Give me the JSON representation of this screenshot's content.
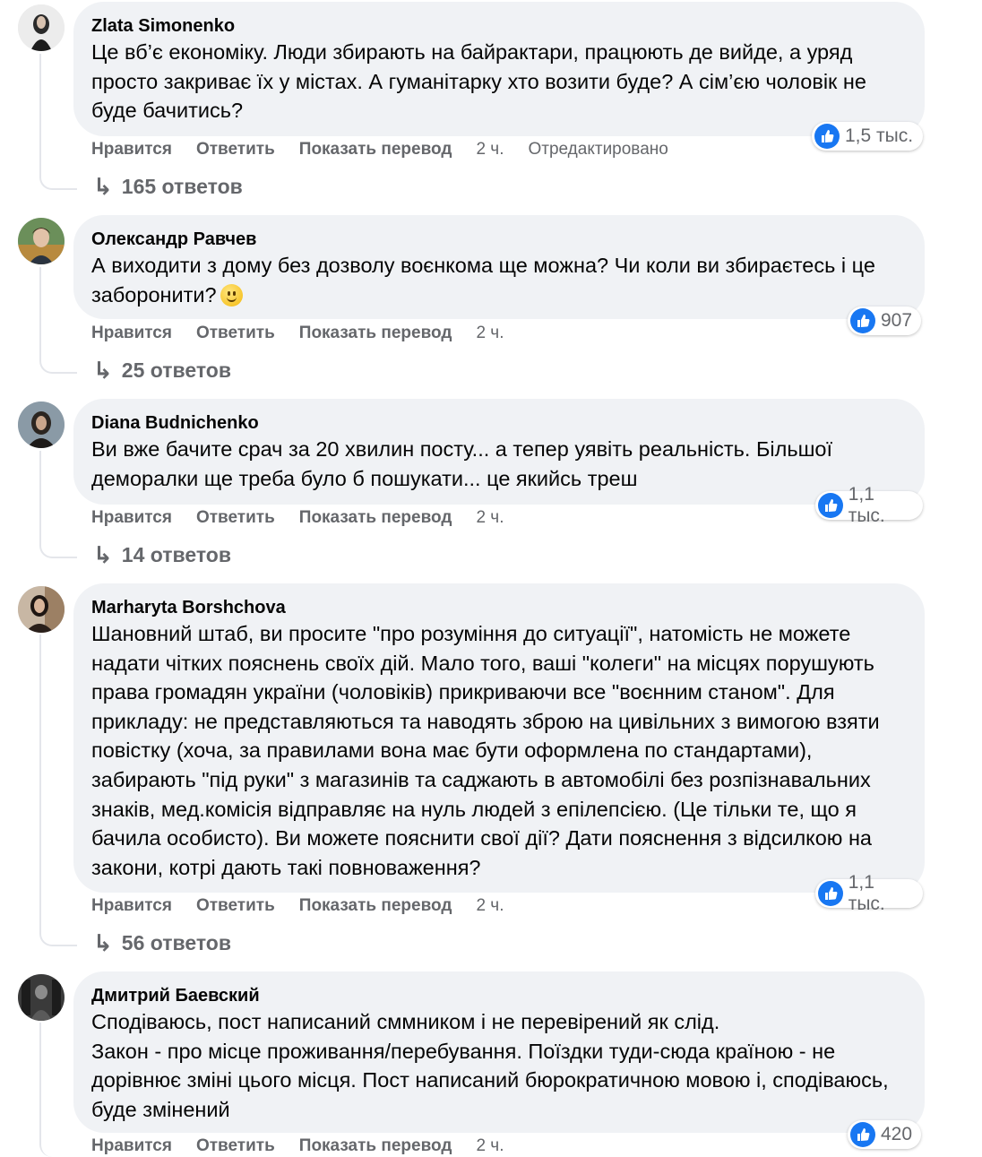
{
  "colors": {
    "bubble": "#f0f2f5",
    "meta_text": "#65676b",
    "like_blue": "#1877f2"
  },
  "actions": {
    "like": "Нравится",
    "reply": "Ответить",
    "translate": "Показать перевод"
  },
  "comments": [
    {
      "author": "Zlata Simonenko",
      "text": "Це вб’є економіку. Люди збирають на байрактари, працюють де вийде, а уряд просто закриває їх у містах. А гуманітарку хто возити буде? А сім’єю чоловік не буде бачитись?",
      "time": "2 ч.",
      "edited": "Отредактировано",
      "reactions": "1,5 тыс.",
      "replies": "165 ответов",
      "reaction_icon": "like-icon"
    },
    {
      "author": "Олександр Равчев",
      "text": "А виходити з дому без дозволу воєнкома ще можна? Чи коли ви збираєтесь і це заборонити?",
      "time": "2 ч.",
      "reactions": "907",
      "replies": "25 ответов",
      "emoji": "slightly-smiling-face-emoji"
    },
    {
      "author": "Diana Budnichenko",
      "text": "Ви вже бачите срач за 20 хвилин посту... а тепер уявіть реальність. Більшої деморалки ще треба було б пошукати... це якийсь треш",
      "time": "2 ч.",
      "reactions": "1,1 тыс.",
      "replies": "14 ответов"
    },
    {
      "author": "Marharyta Borshchova",
      "text": "Шановний штаб, ви просите \"про розуміння до ситуації\", натомість не можете надати чітких пояснень своїх дій. Мало того, ваші \"колеги\" на місцях порушують права громадян україни (чоловіків) прикриваючи все \"воєнним станом\". Для прикладу: не представляються та наводять зброю на цивільних з вимогою взяти повістку (хоча, за правилами вона має бути оформлена по стандартами), забирають \"під руки\" з магазинів та саджають в автомобілі без розпізнавальних знаків, мед.комісія відправляє на нуль людей з епілепсією. (Це тільки те, що я бачила особисто). Ви можете пояснити свої дії? Дати пояснення з відсилкою на закони, котрі дають такі повноваження?",
      "time": "2 ч.",
      "reactions": "1,1 тыс.",
      "replies": "56 ответов"
    },
    {
      "author": "Дмитрий Баевский",
      "text": "Сподіваюсь, пост написаний сммником і не перевірений як слід.\nЗакон - про місце проживання/перебування. Поїздки туди-сюда країною - не дорівнює зміні цього місця. Пост написаний бюрократичною мовою і, сподіваюсь, буде змінений",
      "time": "2 ч.",
      "reactions": "420"
    }
  ]
}
